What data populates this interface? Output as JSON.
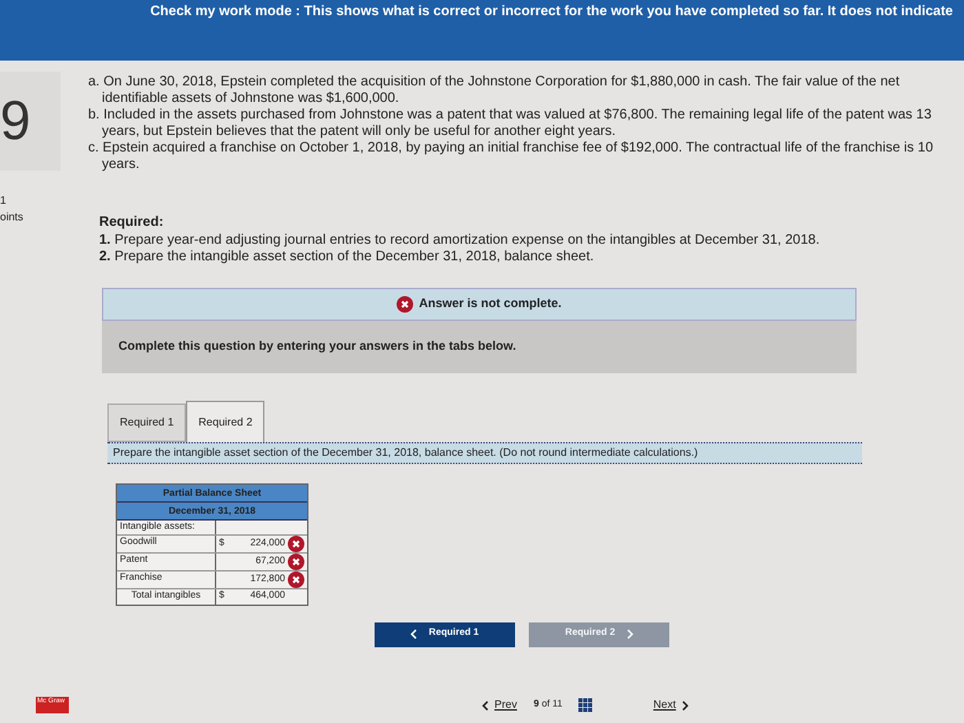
{
  "banner": {
    "text": "Check my work mode : This shows what is correct or incorrect for the work you have completed so far. It does not indicate"
  },
  "question": {
    "number": "9",
    "points_value": "1",
    "points_label": "oints"
  },
  "facts": [
    {
      "text": "a. On June 30, 2018, Epstein completed the acquisition of the Johnstone Corporation for $1,880,000 in cash. The fair value of the net identifiable assets of Johnstone was $1,600,000."
    },
    {
      "text": "b. Included in the assets purchased from Johnstone was a patent that was valued at $76,800. The remaining legal life of the patent was 13 years, but Epstein believes that the patent will only be useful for another eight years."
    },
    {
      "text": "c. Epstein acquired a franchise on October 1, 2018, by paying an initial franchise fee of $192,000. The contractual life of the franchise is 10 years."
    }
  ],
  "required": {
    "heading": "Required:",
    "items": [
      "**1.** Prepare year-end adjusting journal entries to record amortization expense on the intangibles at December 31, 2018.",
      "**2.** Prepare the intangible asset section of the December 31, 2018, balance sheet."
    ]
  },
  "status": {
    "text": "Answer is not complete."
  },
  "instructions": "Complete this question by entering your answers in the tabs below.",
  "tabs": [
    {
      "label": "Required 1",
      "selected": false
    },
    {
      "label": "Required 2",
      "selected": true
    }
  ],
  "tab_prompt": "Prepare the intangible asset section of the December 31, 2018, balance sheet. (Do not round intermediate calculations.)",
  "table": {
    "title": "Partial Balance Sheet",
    "date": "December 31, 2018",
    "rows": [
      {
        "label": "Intangible assets:"
      },
      {
        "label": "Goodwill",
        "currency": "$",
        "value": "224,000",
        "correct": false
      },
      {
        "label": "Patent",
        "value": "67,200",
        "correct": false
      },
      {
        "label": "Franchise",
        "value": "172,800",
        "correct": false
      },
      {
        "label": "Total intangibles",
        "currency": "$",
        "value": "464,000",
        "total": true
      }
    ]
  },
  "nav_buttons": [
    {
      "label": "Required 1",
      "kind": "back",
      "disabled": false
    },
    {
      "label": "Required 2",
      "kind": "forward",
      "disabled": true
    }
  ],
  "footer": {
    "logo": "Mc Graw",
    "prev": "Prev",
    "page": "9",
    "of": "of 11",
    "next": "Next"
  }
}
